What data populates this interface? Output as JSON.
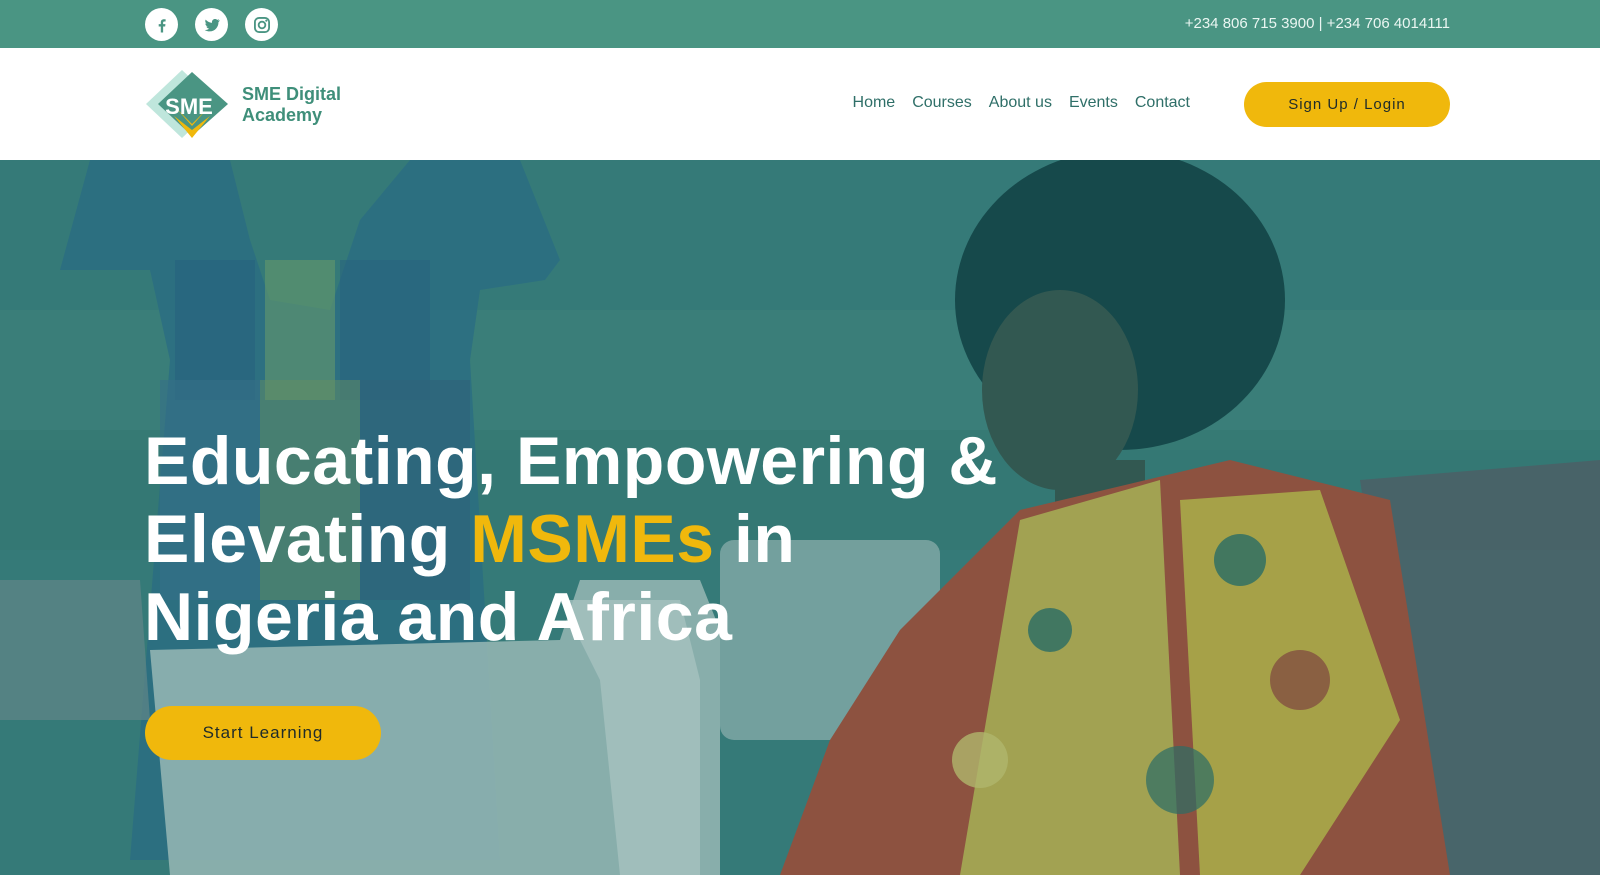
{
  "topbar": {
    "social": [
      "facebook-icon",
      "twitter-icon",
      "instagram-icon"
    ],
    "phones": "+234 806 715 3900 | +234 706 4014111"
  },
  "header": {
    "brand_line1": "SME Digital",
    "brand_line2": "Academy",
    "logo_letters": "SME",
    "nav": [
      "Home",
      "Courses",
      "About us",
      "Events",
      "Contact"
    ],
    "signup_label": "Sign Up / Login"
  },
  "hero": {
    "headline_part1": "Educating, Empowering & Elevating",
    "headline_accent": "MSMEs",
    "headline_part2": "in Nigeria and Africa",
    "cta_label": "Start Learning"
  },
  "colors": {
    "topbar": "#4a9583",
    "accent": "#f0b80c",
    "brand_green": "#3f8f7a",
    "nav_text": "#2f6f68",
    "hero_overlay": "#2e7a76"
  }
}
